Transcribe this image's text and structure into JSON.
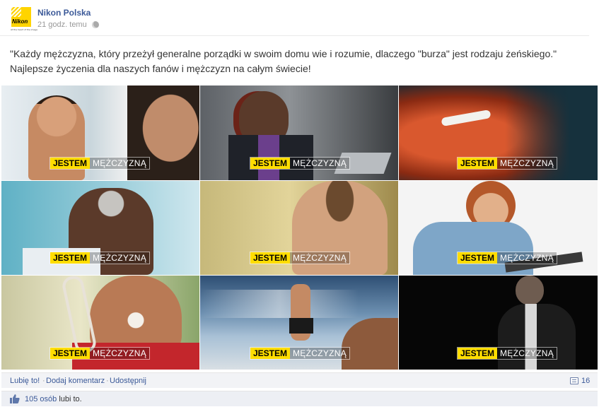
{
  "post": {
    "page_name": "Nikon Polska",
    "time": "21 godz. temu",
    "logo_text": "Nikon",
    "logo_tagline": "At the heart of the image",
    "text_line1": "\"Każdy mężczyzna, który przeżył generalne porządki w swoim domu wie i rozumie, dlaczego \"burza\" jest rodzaju żeńskiego.\"",
    "text_line2": "Najlepsze życzenia dla naszych fanów i mężczyzn na całym świecie!"
  },
  "tiles": [
    {
      "badge_a": "JESTEM",
      "badge_b": "MĘŻCZYZNĄ"
    },
    {
      "badge_a": "JESTEM",
      "badge_b": "MĘŻCZYZNĄ"
    },
    {
      "badge_a": "JESTEM",
      "badge_b": "MĘŻCZYZNĄ"
    },
    {
      "badge_a": "JESTEM",
      "badge_b": "MĘŻCZYZNĄ"
    },
    {
      "badge_a": "JESTEM",
      "badge_b": "MĘŻCZYZNĄ"
    },
    {
      "badge_a": "JESTEM",
      "badge_b": "MĘŻCZYZNĄ"
    },
    {
      "badge_a": "JESTEM",
      "badge_b": "MĘŻCZYZNĄ"
    },
    {
      "badge_a": "JESTEM",
      "badge_b": "MĘŻCZYZNĄ"
    },
    {
      "badge_a": "JESTEM",
      "badge_b": "MĘŻCZYZNĄ"
    }
  ],
  "actions": {
    "like": "Lubię to!",
    "comment": "Dodaj komentarz",
    "share": "Udostępnij",
    "separator": "·",
    "comment_count": "16"
  },
  "likes": {
    "count_link": "105 osób",
    "suffix": " lubi to."
  },
  "colors": {
    "link": "#3b5998",
    "badge_yellow": "#ffdd00"
  },
  "icons": [
    "globe-icon",
    "comment-icon",
    "thumbs-up-icon"
  ]
}
